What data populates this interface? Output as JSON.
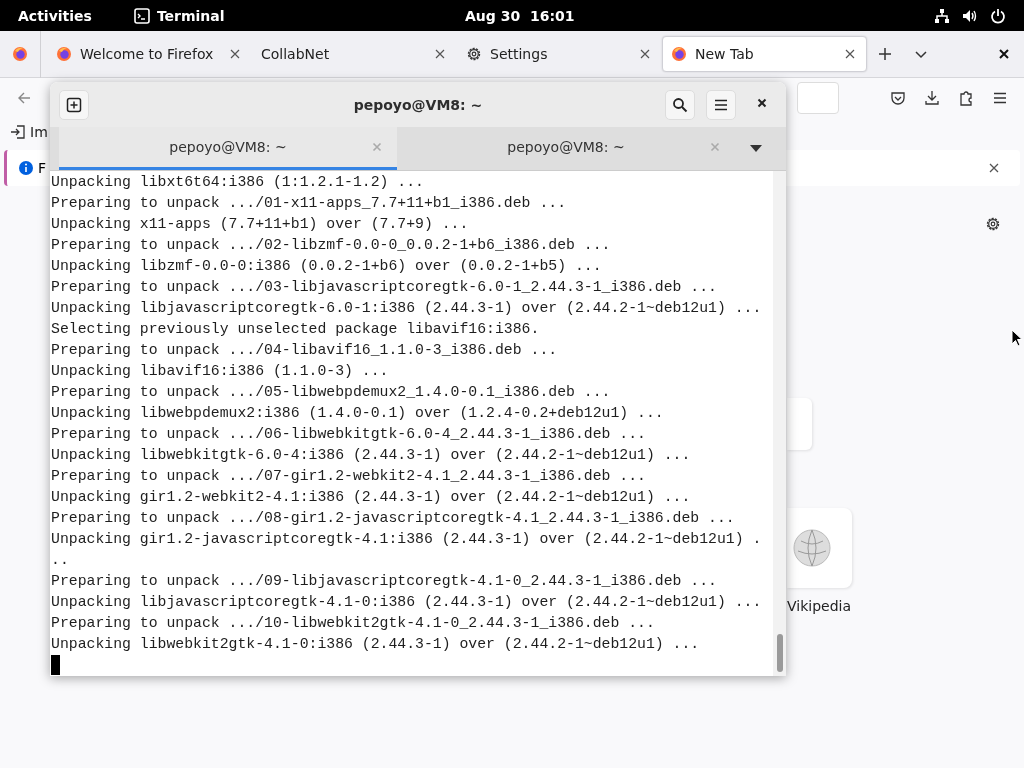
{
  "top_bar": {
    "activities": "Activities",
    "app_name": "Terminal",
    "clock": "Aug 30  16:01"
  },
  "browser": {
    "tabs": [
      {
        "label": "Welcome to Firefox",
        "kind": "firefox",
        "selected": false
      },
      {
        "label": "CollabNet",
        "kind": "plain",
        "selected": false
      },
      {
        "label": "Settings",
        "kind": "settings",
        "selected": false
      },
      {
        "label": "New Tab",
        "kind": "firefox",
        "selected": true
      }
    ],
    "bookmarks": [
      "Im"
    ],
    "notification": {
      "text": "F"
    },
    "shortcuts": [
      {
        "label": "Vikipedia"
      }
    ]
  },
  "terminal": {
    "title": "pepoyo@VM8: ~",
    "tabs": [
      {
        "label": "pepoyo@VM8: ~",
        "selected": true
      },
      {
        "label": "pepoyo@VM8: ~",
        "selected": false
      }
    ],
    "lines": [
      "Unpacking libxt6t64:i386 (1:1.2.1-1.2) ...",
      "Preparing to unpack .../01-x11-apps_7.7+11+b1_i386.deb ...",
      "Unpacking x11-apps (7.7+11+b1) over (7.7+9) ...",
      "Preparing to unpack .../02-libzmf-0.0-0_0.0.2-1+b6_i386.deb ...",
      "Unpacking libzmf-0.0-0:i386 (0.0.2-1+b6) over (0.0.2-1+b5) ...",
      "Preparing to unpack .../03-libjavascriptcoregtk-6.0-1_2.44.3-1_i386.deb ...",
      "Unpacking libjavascriptcoregtk-6.0-1:i386 (2.44.3-1) over (2.44.2-1~deb12u1) ...",
      "Selecting previously unselected package libavif16:i386.",
      "Preparing to unpack .../04-libavif16_1.1.0-3_i386.deb ...",
      "Unpacking libavif16:i386 (1.1.0-3) ...",
      "Preparing to unpack .../05-libwebpdemux2_1.4.0-0.1_i386.deb ...",
      "Unpacking libwebpdemux2:i386 (1.4.0-0.1) over (1.2.4-0.2+deb12u1) ...",
      "Preparing to unpack .../06-libwebkitgtk-6.0-4_2.44.3-1_i386.deb ...",
      "Unpacking libwebkitgtk-6.0-4:i386 (2.44.3-1) over (2.44.2-1~deb12u1) ...",
      "Preparing to unpack .../07-gir1.2-webkit2-4.1_2.44.3-1_i386.deb ...",
      "Unpacking gir1.2-webkit2-4.1:i386 (2.44.3-1) over (2.44.2-1~deb12u1) ...",
      "Preparing to unpack .../08-gir1.2-javascriptcoregtk-4.1_2.44.3-1_i386.deb ...",
      "Unpacking gir1.2-javascriptcoregtk-4.1:i386 (2.44.3-1) over (2.44.2-1~deb12u1) .",
      "..",
      "Preparing to unpack .../09-libjavascriptcoregtk-4.1-0_2.44.3-1_i386.deb ...",
      "Unpacking libjavascriptcoregtk-4.1-0:i386 (2.44.3-1) over (2.44.2-1~deb12u1) ...",
      "Preparing to unpack .../10-libwebkit2gtk-4.1-0_2.44.3-1_i386.deb ...",
      "Unpacking libwebkit2gtk-4.1-0:i386 (2.44.3-1) over (2.44.2-1~deb12u1) ..."
    ]
  }
}
